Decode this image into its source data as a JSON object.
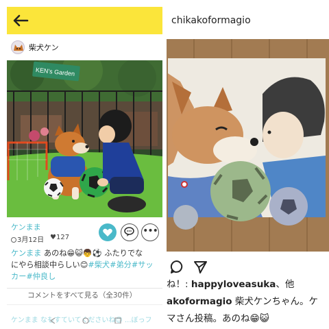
{
  "left_app": {
    "header": {
      "back_icon": "arrow-left-icon",
      "bg_color": "#fbe53a"
    },
    "author": {
      "name": "柴犬ケン",
      "avatar_icon": "dog-avatar-icon"
    },
    "photo": {
      "sign_text": "KEN's Garden",
      "description_icons": [
        "shiba-dog",
        "boy",
        "soccer-ball",
        "goal"
      ]
    },
    "post_meta": {
      "user": "ケンまま",
      "date": "3月12日",
      "likes": "127",
      "like_icon": "heart-icon",
      "comment_icon": "comment-bubble-icon",
      "more_icon": "more-dots-icon",
      "accent_color": "#4ab9c9"
    },
    "caption": {
      "user": "ケンまま",
      "text_1": "あのね😁😺👦⚽ ふたりでな",
      "text_2": "にやら相談中らしい😊",
      "hashtags_line2": "#柴犬#弟分#サッ",
      "hashtags_line3": "カー#仲良し"
    },
    "see_all_comments": "コメントをすべて見る（全30件）",
    "next_comment_fragment": "ケンまま なもすていてくださいね😊 ...ぼっフ"
  },
  "right_app": {
    "username": "chikakoformagio",
    "photo": {
      "description_icons": [
        "painted-shiba",
        "painted-boy",
        "soccer-ball"
      ]
    },
    "actions": {
      "comment_icon": "comment-outline-icon",
      "share_icon": "send-icon"
    },
    "likes_line": {
      "prefix": "ね！: ",
      "bold": "happyloveasuka",
      "suffix": "、他"
    },
    "caption_line_1": {
      "bold": "akoformagio",
      "text": " 柴犬ケンちゃん。ケ"
    },
    "caption_line_2": "マさん投稿。あのね😁😺"
  }
}
